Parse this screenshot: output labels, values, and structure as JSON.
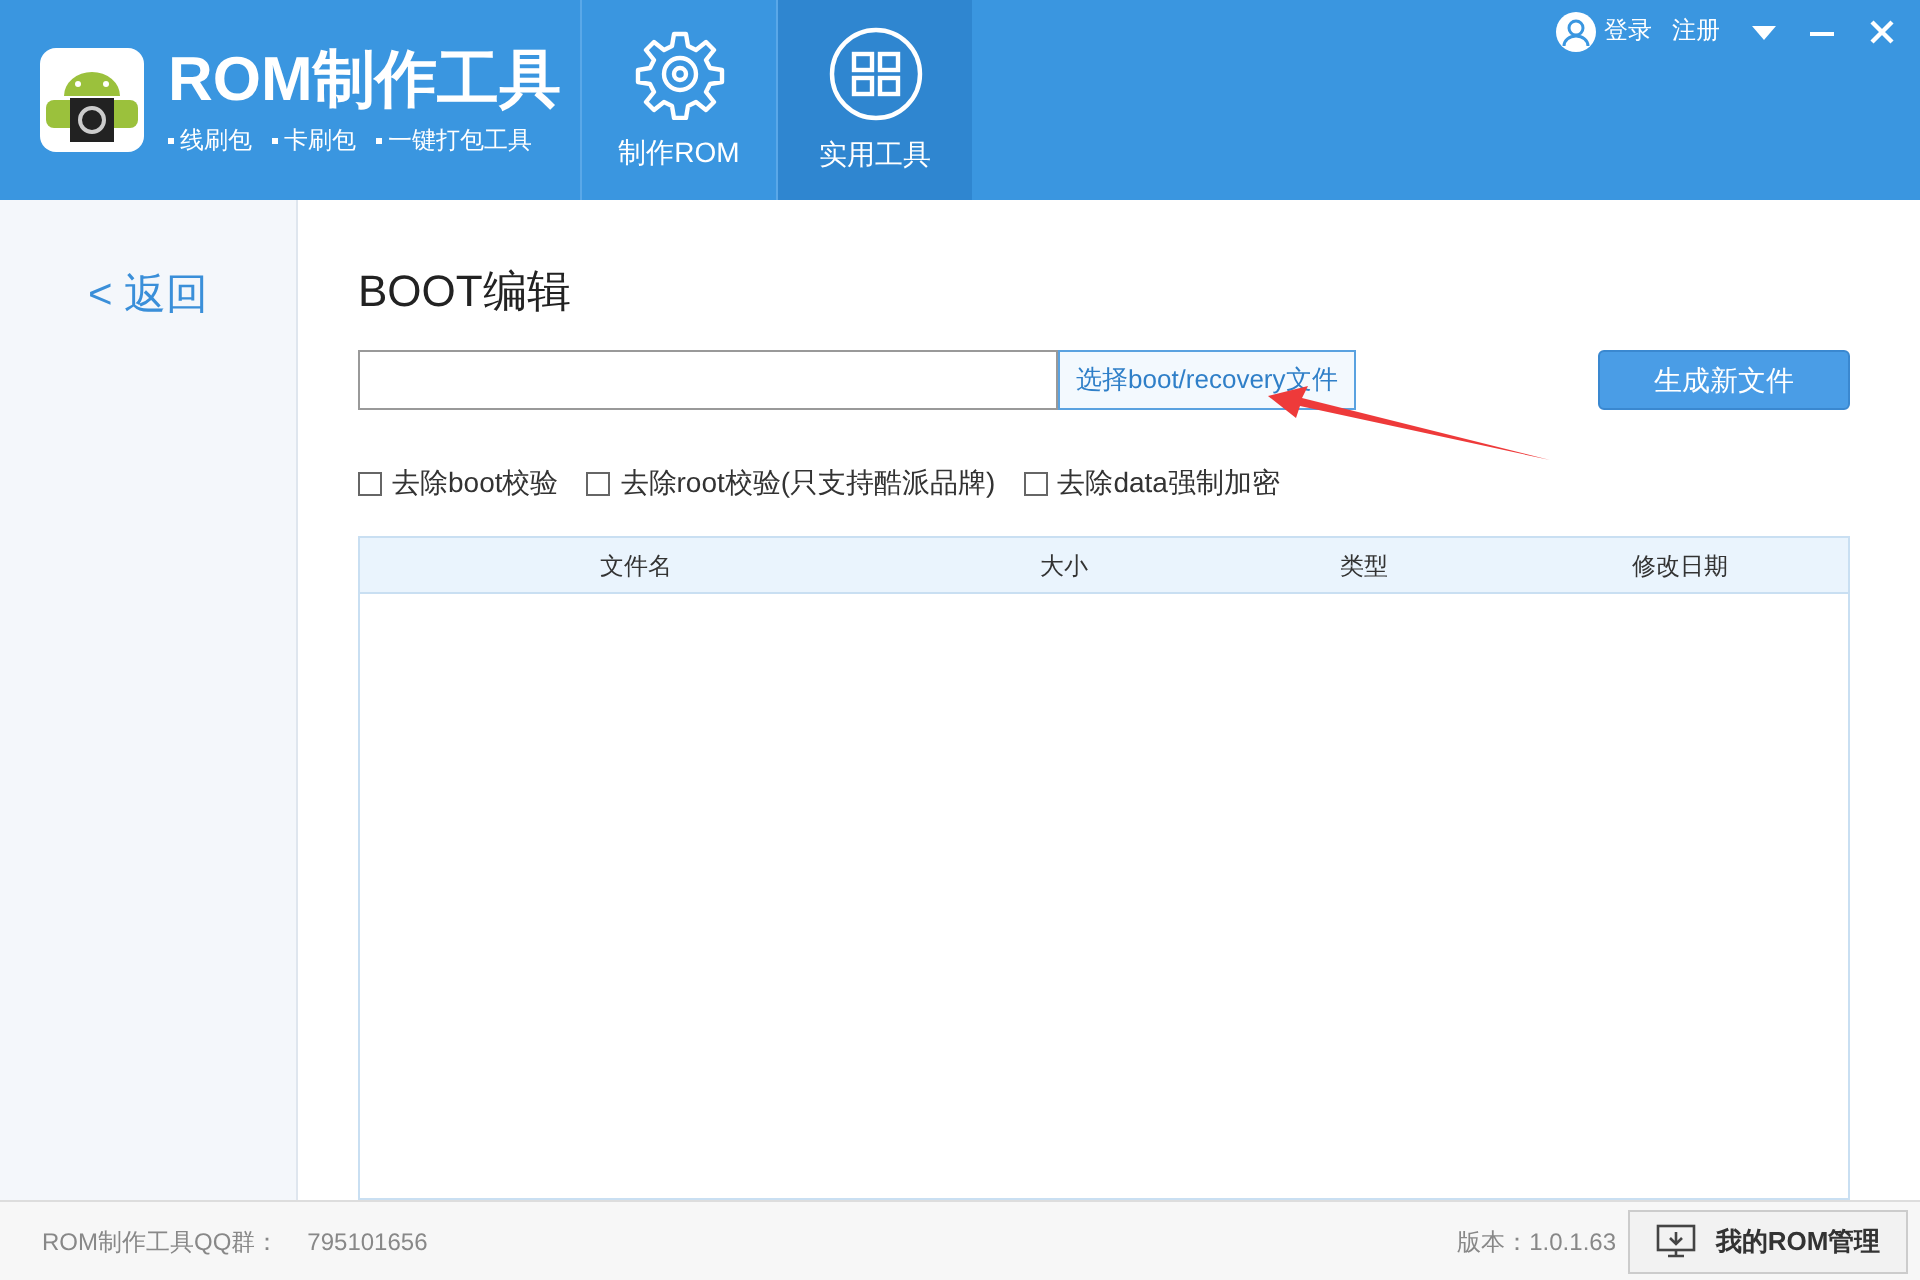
{
  "app": {
    "title": "ROM制作工具",
    "features": [
      "线刷包",
      "卡刷包",
      "一键打包工具"
    ]
  },
  "nav_tabs": [
    {
      "label": "制作ROM",
      "kind": "gear",
      "selected": false
    },
    {
      "label": "实用工具",
      "kind": "grid",
      "selected": true
    }
  ],
  "account": {
    "login": "登录",
    "register": "注册"
  },
  "sidebar": {
    "back": "< 返回"
  },
  "page": {
    "title": "BOOT编辑",
    "choose_button": "选择boot/recovery文件",
    "generate_button": "生成新文件",
    "options": [
      {
        "label": "去除boot校验",
        "checked": false
      },
      {
        "label": "去除root校验(只支持酷派品牌)",
        "checked": false
      },
      {
        "label": "去除data强制加密",
        "checked": false
      }
    ],
    "table": {
      "columns": [
        "文件名",
        "大小",
        "类型",
        "修改日期"
      ]
    }
  },
  "status_bar": {
    "qq_label": "ROM制作工具QQ群：",
    "qq_number": "795101656",
    "version": "版本：1.0.1.63",
    "rom_button": "我的ROM管理"
  }
}
